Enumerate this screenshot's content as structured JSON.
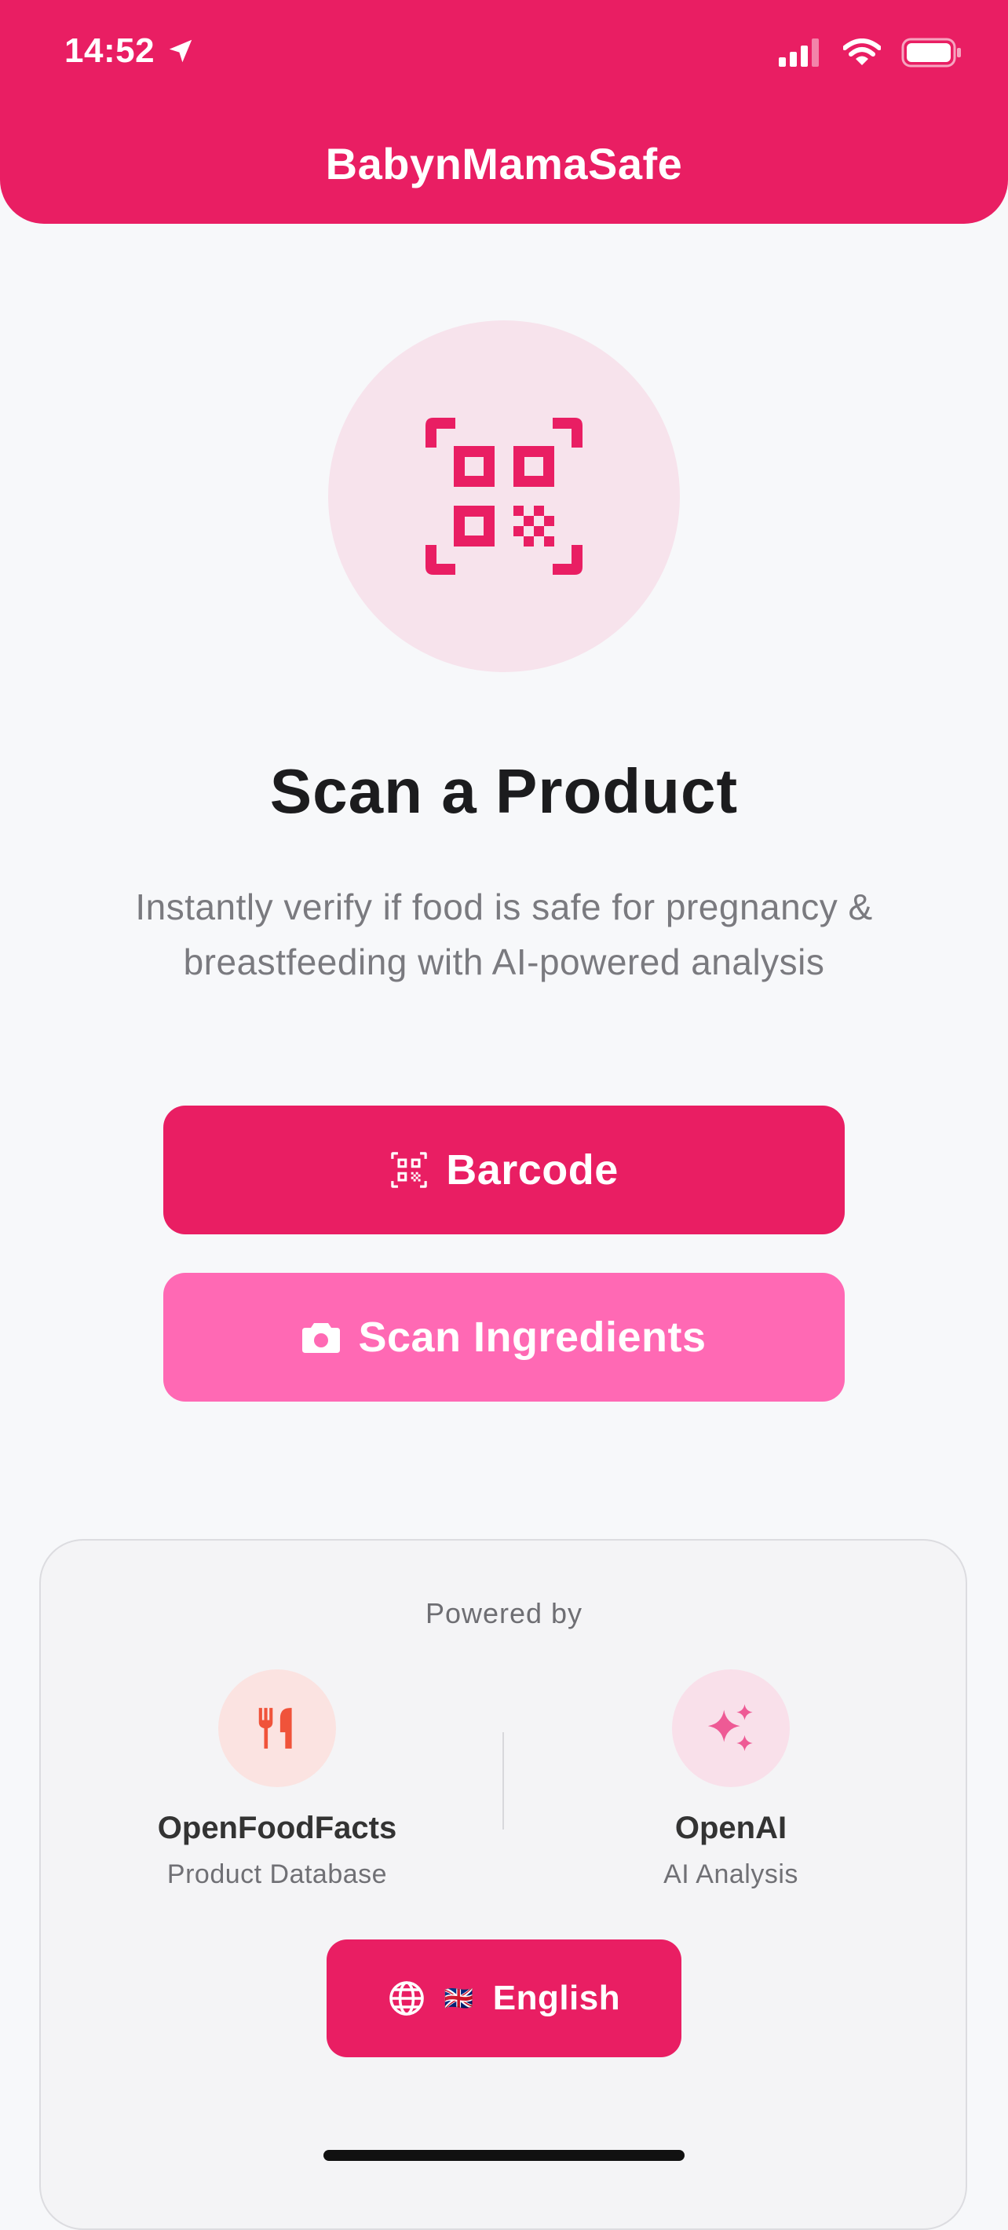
{
  "status_bar": {
    "time": "14:52"
  },
  "header": {
    "title": "BabynMamaSafe"
  },
  "hero": {
    "icon": "qr-scan-icon",
    "title": "Scan a Product",
    "subtitle_line1": "Instantly verify if food is safe for pregnancy &",
    "subtitle_line2": "breastfeeding with AI-powered analysis"
  },
  "actions": {
    "barcode_label": "Barcode",
    "ingredients_label": "Scan Ingredients"
  },
  "powered": {
    "heading": "Powered by",
    "providers": [
      {
        "name": "OpenFoodFacts",
        "desc": "Product Database",
        "icon": "utensils-icon"
      },
      {
        "name": "OpenAI",
        "desc": "AI Analysis",
        "icon": "sparkles-icon"
      }
    ]
  },
  "language": {
    "flag": "🇬🇧",
    "label": "English"
  },
  "colors": {
    "primary": "#e91e63",
    "secondary": "#ff69b4",
    "background": "#f7f8fa"
  }
}
